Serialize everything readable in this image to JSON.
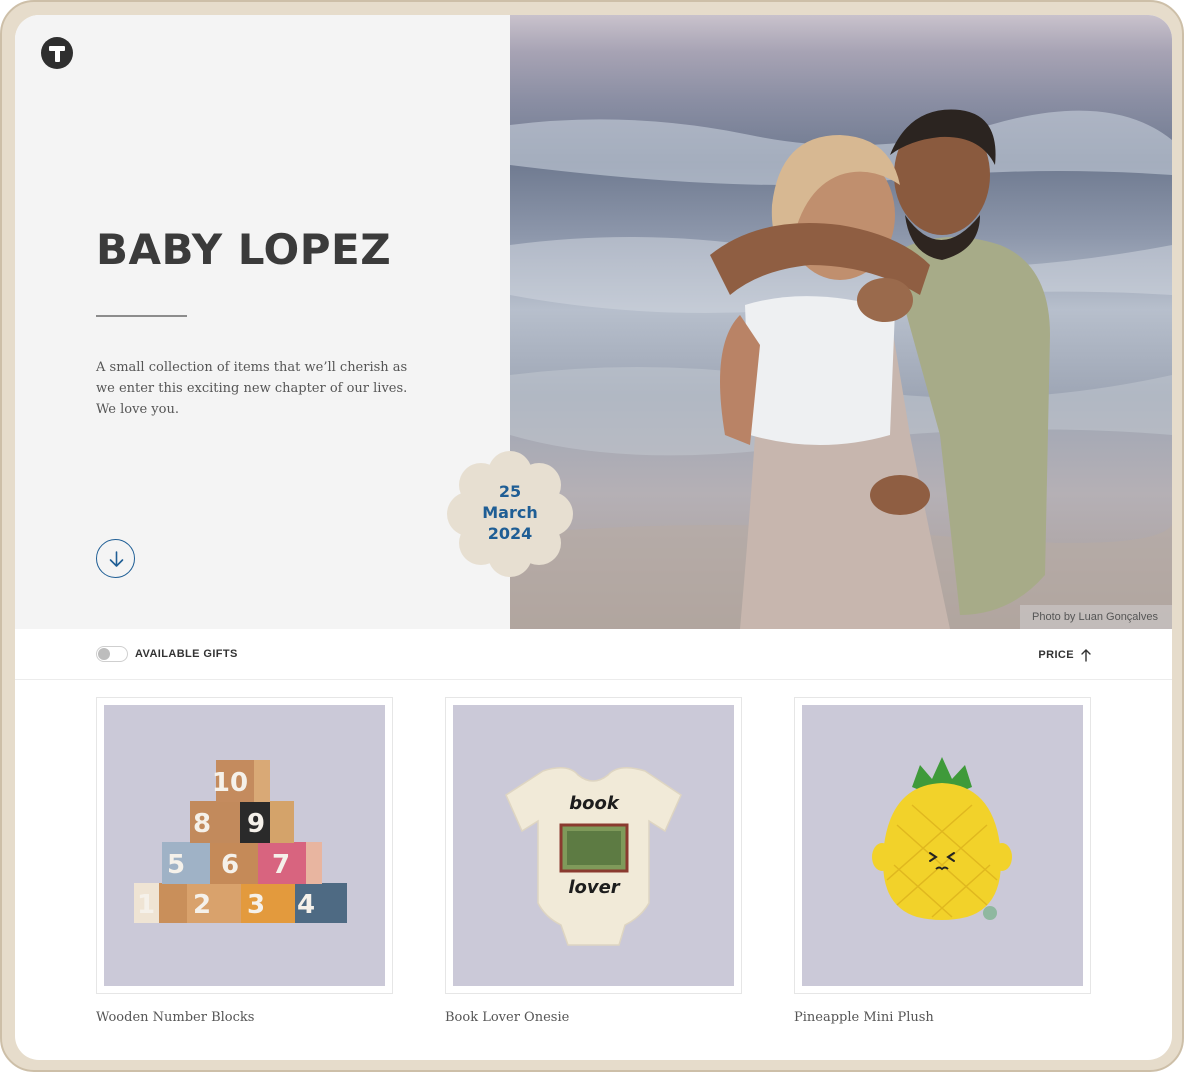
{
  "hero": {
    "title": "BABY LOPEZ",
    "description_lines": [
      "A small collection of items that we’ll cherish as",
      "we enter this exciting new chapter of our lives.",
      "We love you."
    ],
    "photo_credit": "Photo by Luan Gonçalves",
    "date": {
      "day": "25",
      "month": "March",
      "year": "2024"
    }
  },
  "filter": {
    "toggle_label": "AVAILABLE GIFTS",
    "sort_label": "PRICE"
  },
  "products": [
    {
      "name": "Wooden Number Blocks"
    },
    {
      "name": "Book Lover Onesie"
    },
    {
      "name": "Pineapple Mini Plush"
    }
  ],
  "onesie_print": {
    "top": "book",
    "bottom": "lover"
  },
  "colors": {
    "accent": "#1f5e95",
    "frame": "#e6dccb",
    "badge": "#e7dfd1",
    "product_bg": "#cbc9d8"
  }
}
